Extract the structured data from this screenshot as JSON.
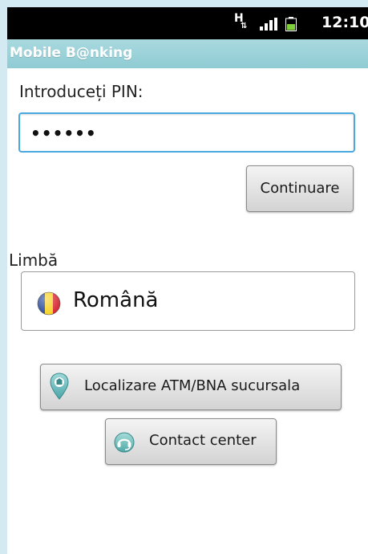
{
  "status_bar": {
    "network": "H",
    "time": "12:10"
  },
  "app": {
    "title": "Mobile B@nking"
  },
  "login": {
    "pin_label": "Introduceți PIN:",
    "pin_value": "••••••",
    "continue_label": "Continuare"
  },
  "language": {
    "label": "Limbă",
    "selected": "Română",
    "flag_icon": "romania-flag-icon"
  },
  "actions": {
    "atm_label": "Localizare ATM/BNA sucursala",
    "atm_icon": "map-pin-icon",
    "contact_label": "Contact center",
    "contact_icon": "headset-icon"
  },
  "colors": {
    "title_bar": "#9fd3da",
    "field_focus": "#4aa8e0",
    "frame_background": "#d4eaf2"
  }
}
